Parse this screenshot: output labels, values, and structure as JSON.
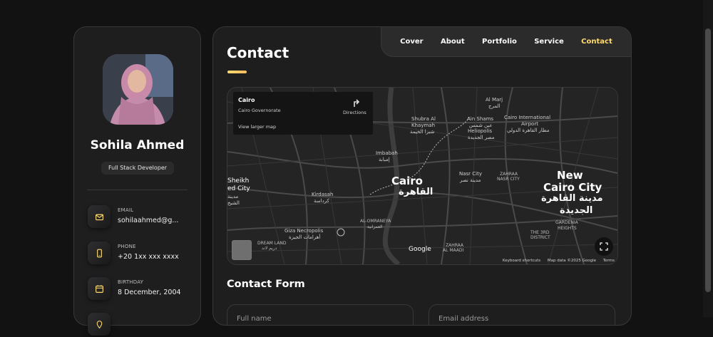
{
  "profile": {
    "name": "Sohila Ahmed",
    "role": "Full Stack Developer"
  },
  "contacts": [
    {
      "label": "EMAIL",
      "value": "sohilaahmed@g...",
      "icon": "mail-icon"
    },
    {
      "label": "PHONE",
      "value": "+20 1xx xxx xxxx",
      "icon": "phone-icon"
    },
    {
      "label": "BIRTHDAY",
      "value": "8 December, 2004",
      "icon": "calendar-icon"
    }
  ],
  "nav": {
    "items": [
      "Cover",
      "About",
      "Portfolio",
      "Service",
      "Contact"
    ],
    "active": "Contact"
  },
  "page": {
    "title": "Contact"
  },
  "map": {
    "place_name": "Cairo",
    "place_sub": "Cairo Governorate",
    "directions": "Directions",
    "larger_map": "View larger map",
    "labels": {
      "cairo": "Cairo",
      "cairo_ar": "القاهرة",
      "new_cairo": "New",
      "new_cairo2": "Cairo City",
      "new_cairo_ar": "مدينة القاهرة",
      "new_cairo_ar2": "الجديدة",
      "shubra": "Shubra Al",
      "shubra2": "Khaymah",
      "shubra_ar": "شبرا الخيمة",
      "imbabah": "Imbabah",
      "imbabah_ar": "إمبابة",
      "ain_shams": "Ain Shams",
      "ain_shams_ar": "عين شمس",
      "heliopolis": "Heliopolis",
      "heliopolis_ar": "مصر الجديدة",
      "airport": "Cairo International",
      "airport2": "Airport",
      "airport_ar": "مطار القاهرة الدولي",
      "al_marj": "Al Marj",
      "al_marj_ar": "المرج",
      "nasr_city": "Nasr City",
      "nasr_city_ar": "مدينة نصر",
      "zahraa": "ZAHRAA",
      "zahraa2": "NASR CITY",
      "kirdasah": "Kirdasah",
      "kirdasah_ar": "كرداسة",
      "sheikh": "Sheikh",
      "sheikh2": "ed City",
      "sheikh_ar": "مدينة",
      "sheikh_ar2": "الشيخ",
      "giza": "Giza Necropolis",
      "giza_ar": "أهرامات الجيزة",
      "omraneya": "AL-OMRANEYA",
      "omraneya_ar": "العمرانية",
      "dream_land": "DREAM LAND",
      "dream_land_ar": "دريم لاند",
      "maadi": "ZAHRAA",
      "maadi2": "AL MAADI",
      "third_district": "THE 3RD",
      "third_district2": "DISTRICT",
      "gardenia": "GARDENIA",
      "gardenia2": "HEIGHTS",
      "google": "Google"
    },
    "footer": {
      "shortcuts": "Keyboard shortcuts",
      "data": "Map data ©2025 Google",
      "terms": "Terms"
    }
  },
  "form": {
    "title": "Contact Form",
    "fullname_placeholder": "Full name",
    "email_placeholder": "Email address"
  },
  "colors": {
    "accent": "#ffdb70",
    "background": "#121212",
    "card": "#1e1e1f"
  }
}
